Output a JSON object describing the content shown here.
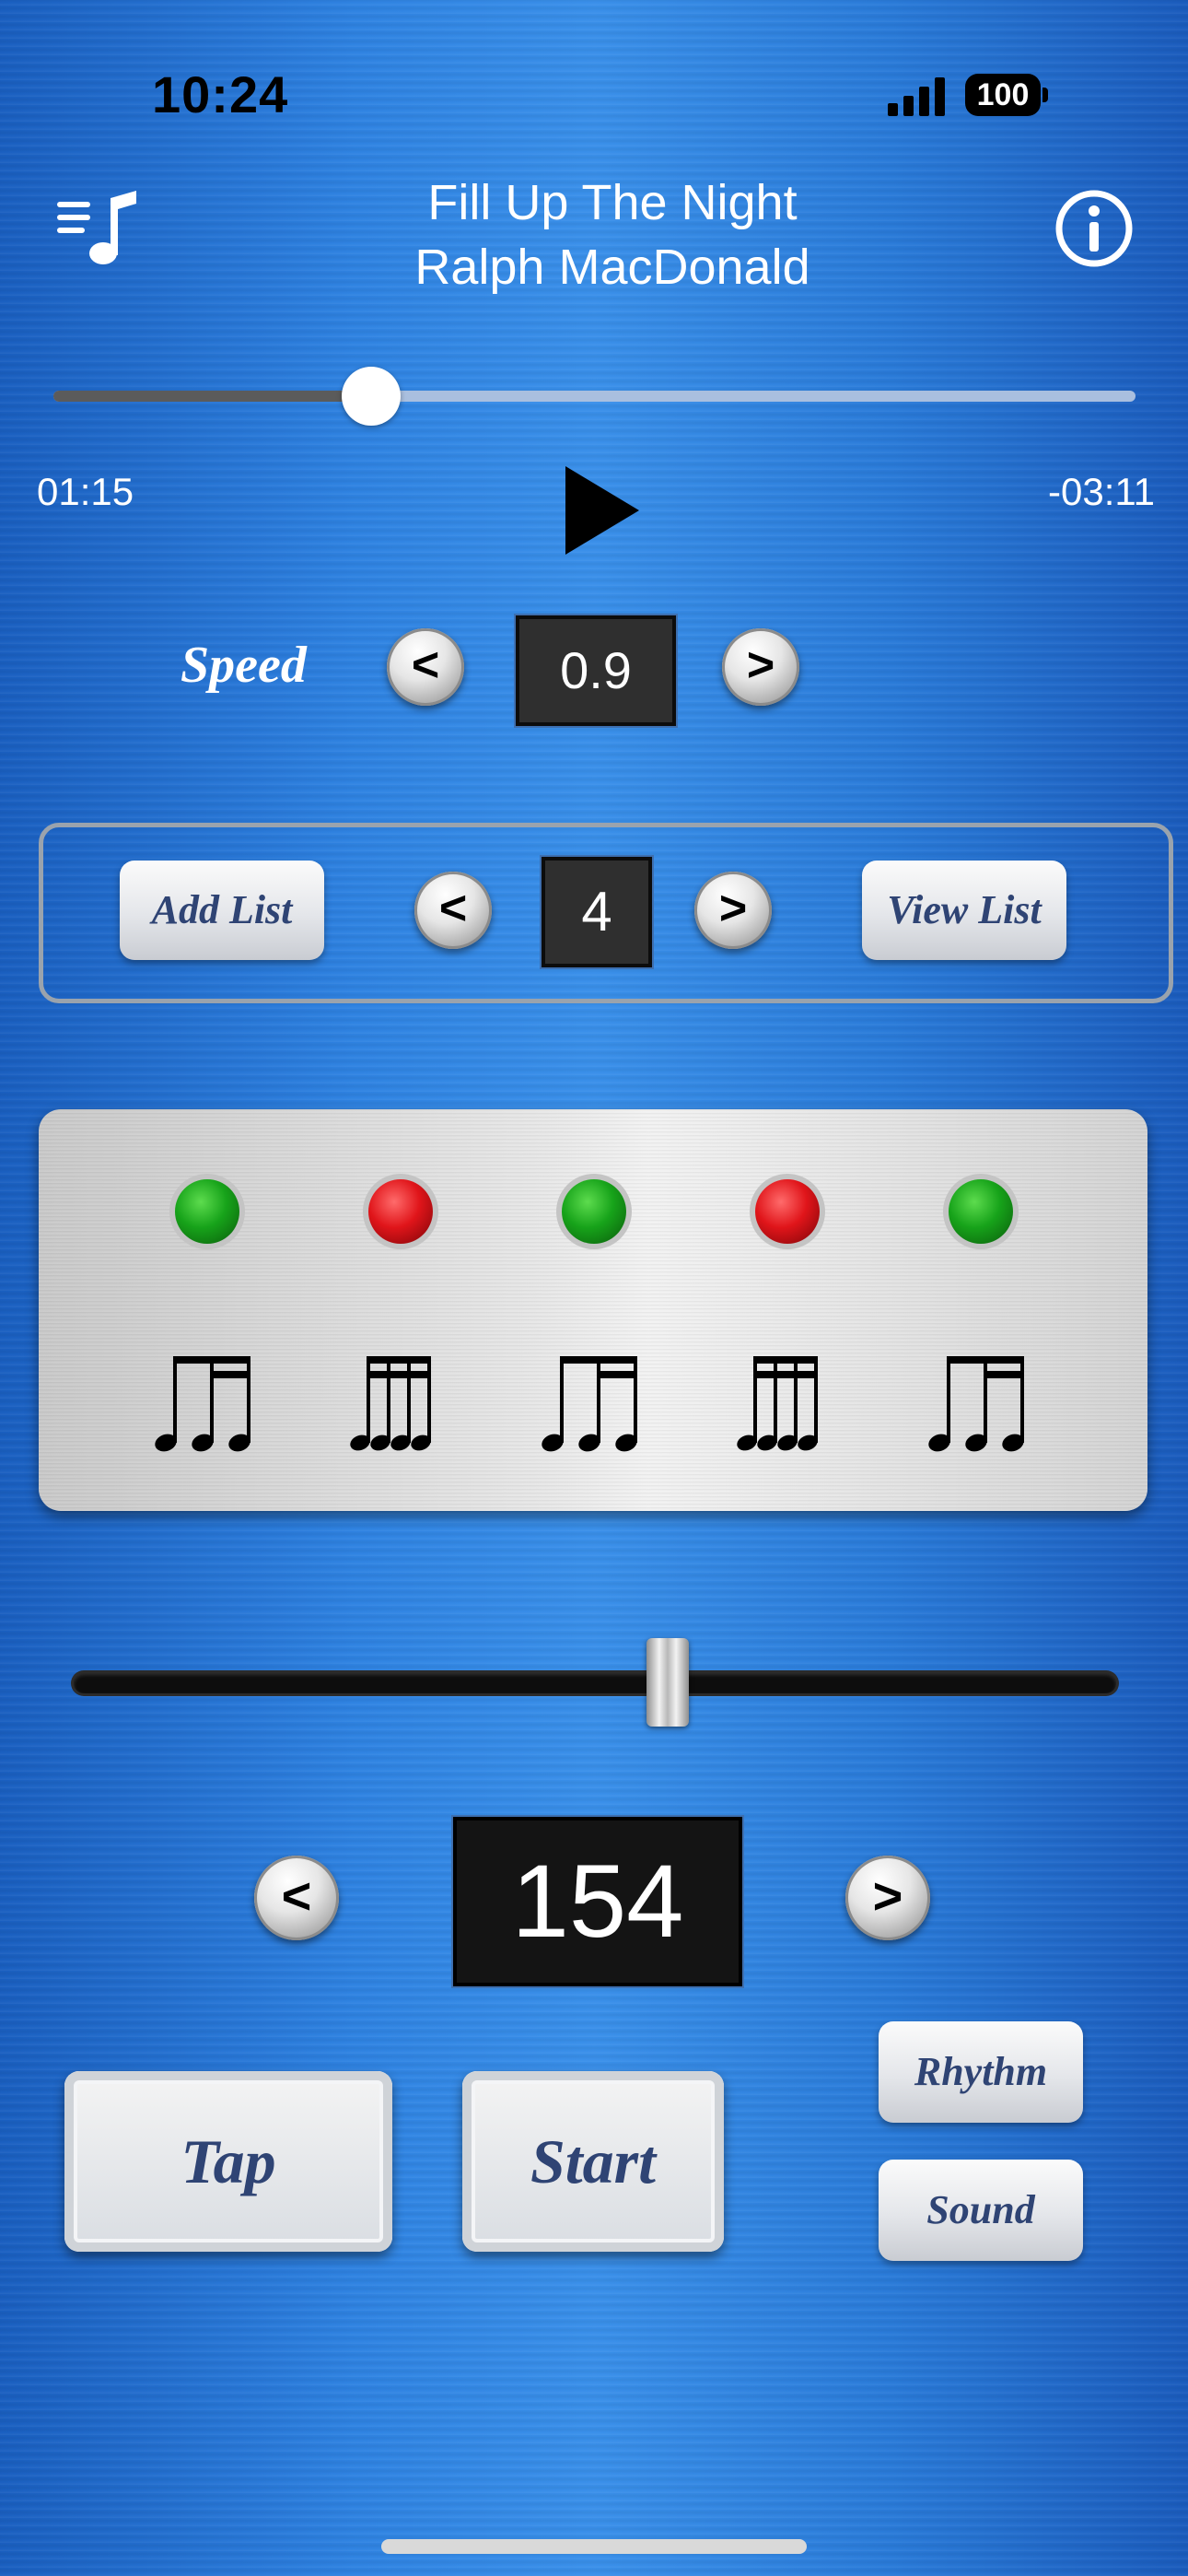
{
  "status_bar": {
    "time": "10:24",
    "battery": "100"
  },
  "now_playing": {
    "title": "Fill Up The Night",
    "artist": "Ralph MacDonald",
    "elapsed": "01:15",
    "remaining": "-03:11",
    "progress_fraction": 0.294
  },
  "speed": {
    "label": "Speed",
    "value": "0.9",
    "dec": "<",
    "inc": ">"
  },
  "list": {
    "add_label": "Add List",
    "view_label": "View List",
    "value": "4",
    "dec": "<",
    "inc": ">"
  },
  "beats": {
    "leds": [
      "green",
      "red",
      "green",
      "red",
      "green"
    ],
    "patterns": [
      "eighth-two-sixteenths",
      "four-sixteenths",
      "eighth-two-sixteenths",
      "four-sixteenths",
      "eighth-two-sixteenths"
    ]
  },
  "tempo": {
    "bpm": "154",
    "dec": "<",
    "inc": ">",
    "slider_fraction": 0.57
  },
  "controls": {
    "tap_label": "Tap",
    "start_label": "Start",
    "rhythm_label": "Rhythm",
    "sound_label": "Sound"
  },
  "icons": [
    "playlist-icon",
    "info-icon",
    "play-icon",
    "signal-icon",
    "battery-icon"
  ],
  "colors": {
    "background": "#2f83e2",
    "button_text": "#2f4474",
    "led_green": "#17a31a",
    "led_red": "#e0151a"
  }
}
